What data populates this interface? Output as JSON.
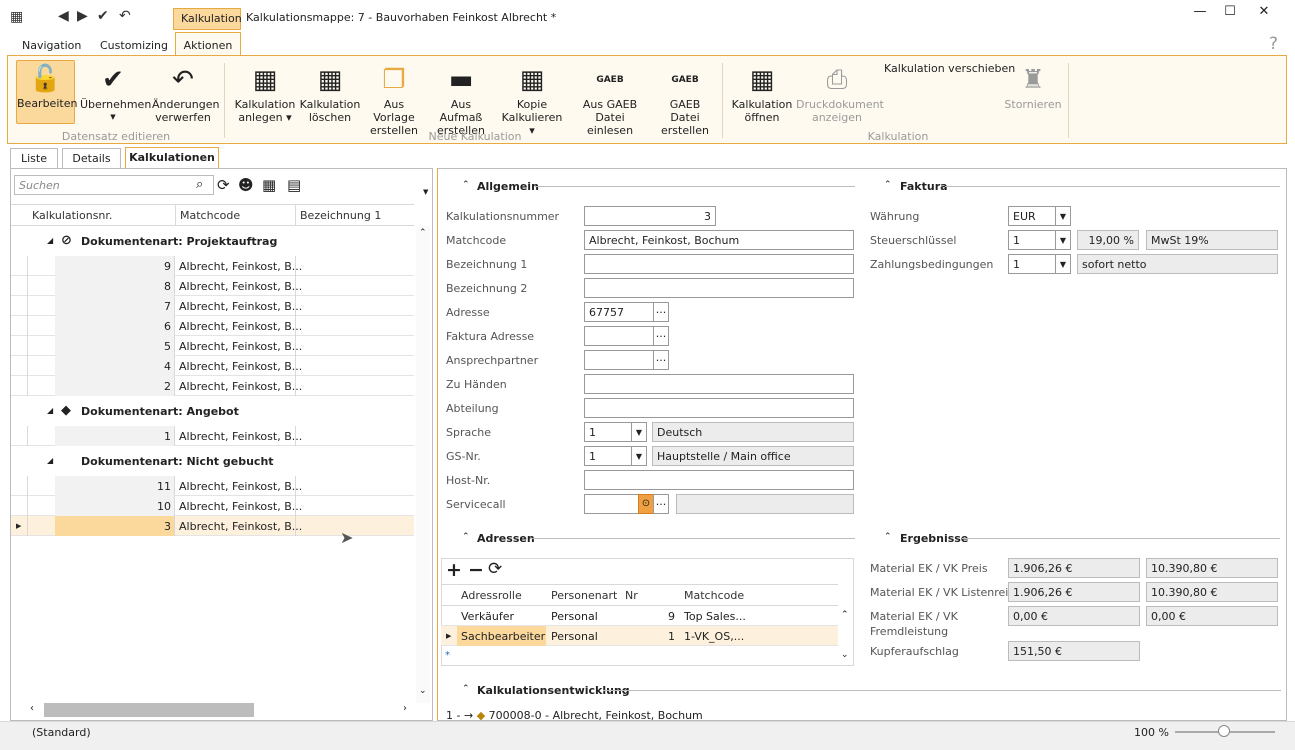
{
  "window": {
    "context_tab": "Kalkulation",
    "title": "Kalkulationsmappe: 7 - Bauvorhaben Feinkost Albrecht *",
    "help": "?"
  },
  "ribbon_tabs": [
    "Navigation",
    "Customizing",
    "Aktionen"
  ],
  "ribbon": {
    "bearbeiten": "Bearbeiten",
    "uebernehmen": "Übernehmen",
    "aenderungen1": "Änderungen",
    "aenderungen2": "verwerfen",
    "group1": "Datensatz editieren",
    "kalk_anlegen1": "Kalkulation",
    "kalk_anlegen2": "anlegen",
    "kalk_loeschen1": "Kalkulation",
    "kalk_loeschen2": "löschen",
    "vorlage1": "Aus Vorlage",
    "vorlage2": "erstellen",
    "aufmass1": "Aus Aufmaß",
    "aufmass2": "erstellen",
    "kopie1": "Kopie",
    "kopie2": "Kalkulieren",
    "gaeb_datei1": "Aus GAEB Datei",
    "gaeb_datei2": "einlesen",
    "gaeb_erst1": "GAEB Datei",
    "gaeb_erst2": "erstellen",
    "group2": "Neue Kalkulation",
    "kalk_oeffnen1": "Kalkulation",
    "kalk_oeffnen2": "öffnen",
    "druck1": "Druckdokument",
    "druck2": "anzeigen",
    "verschieben": "Kalkulation verschieben",
    "stornieren": "Stornieren",
    "group3": "Kalkulation",
    "gaeb_label": "GAEB"
  },
  "tabs": [
    "Liste",
    "Details",
    "Kalkulationen"
  ],
  "list": {
    "search_placeholder": "Suchen",
    "headers": [
      "Kalkulationsnr.",
      "Matchcode",
      "Bezeichnung 1"
    ],
    "groups": [
      {
        "label": "Dokumentenart: Projektauftrag",
        "rows": [
          [
            "9",
            "Albrecht, Feinkost, B..."
          ],
          [
            "8",
            "Albrecht, Feinkost, B..."
          ],
          [
            "7",
            "Albrecht, Feinkost, B..."
          ],
          [
            "6",
            "Albrecht, Feinkost, B..."
          ],
          [
            "5",
            "Albrecht, Feinkost, B..."
          ],
          [
            "4",
            "Albrecht, Feinkost, B..."
          ],
          [
            "2",
            "Albrecht, Feinkost, B..."
          ]
        ]
      },
      {
        "label": "Dokumentenart: Angebot",
        "rows": [
          [
            "1",
            "Albrecht, Feinkost, B..."
          ]
        ]
      },
      {
        "label": "Dokumentenart: Nicht gebucht",
        "rows": [
          [
            "11",
            "Albrecht, Feinkost, B..."
          ],
          [
            "10",
            "Albrecht, Feinkost, B..."
          ],
          [
            "3",
            "Albrecht, Feinkost, B..."
          ]
        ]
      }
    ]
  },
  "allgemein": {
    "title": "Allgemein",
    "labels": [
      "Kalkulationsnummer",
      "Matchcode",
      "Bezeichnung 1",
      "Bezeichnung 2",
      "Adresse",
      "Faktura Adresse",
      "Ansprechpartner",
      "Zu Händen",
      "Abteilung",
      "Sprache",
      "GS-Nr.",
      "Host-Nr.",
      "Servicecall"
    ],
    "kalkulationsnummer": "3",
    "matchcode": "Albrecht, Feinkost, Bochum",
    "adresse": "67757",
    "sprache": "1",
    "sprache_text": "Deutsch",
    "gsnr": "1",
    "gsnr_text": "Hauptstelle / Main office",
    "dots": "..."
  },
  "faktura": {
    "title": "Faktura",
    "labels": [
      "Währung",
      "Steuerschlüssel",
      "Zahlungsbedingungen"
    ],
    "waehrung": "EUR",
    "steuer": "1",
    "steuer_pct": "19,00 %",
    "steuer_text": "MwSt 19%",
    "zahlung": "1",
    "zahlung_text": "sofort netto"
  },
  "adressen": {
    "title": "Adressen",
    "headers": [
      "Adressrolle",
      "Personenart",
      "Nr",
      "Matchcode"
    ],
    "rows": [
      [
        "Verkäufer",
        "Personal",
        "9",
        "Top Sales..."
      ],
      [
        "Sachbearbeiter",
        "Personal",
        "1",
        "1-VK_OS,..."
      ]
    ],
    "newrow": "*"
  },
  "ergebnisse": {
    "title": "Ergebnisse",
    "l1": "Material EK / VK Preis",
    "v1a": "1.906,26 €",
    "v1b": "10.390,80 €",
    "l2": "Material EK / VK Listenreis",
    "v2a": "1.906,26 €",
    "v2b": "10.390,80 €",
    "l3a": "Material EK / VK",
    "l3b": "Fremdleistung",
    "v3a": "0,00 €",
    "v3b": "0,00 €",
    "l4": "Kupferaufschlag",
    "v4": "151,50 €"
  },
  "entwicklung": {
    "title": "Kalkulationsentwicklung",
    "item": "700008-0 - Albrecht, Feinkost, Bochum",
    "prefix": "1 -"
  },
  "status": {
    "left": "(Standard)",
    "zoom": "100 %"
  }
}
